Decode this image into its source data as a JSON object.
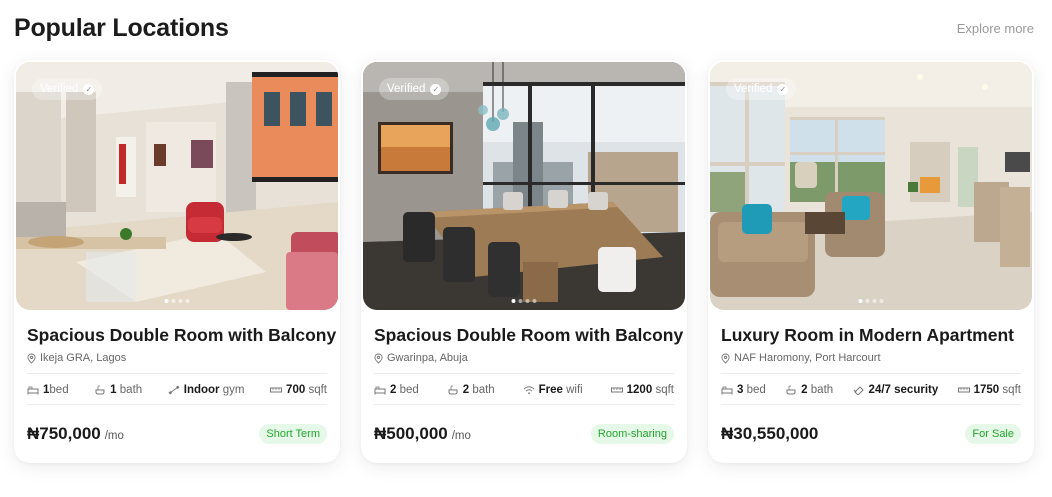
{
  "header": {
    "title": "Popular Locations",
    "explore_label": "Explore more"
  },
  "cards": [
    {
      "verified": "Verified",
      "name": "Spacious Double Room with Balcony",
      "location": "Ikeja GRA, Lagos",
      "features": [
        {
          "bold": "1",
          "text": "bed",
          "icon": "bed-icon"
        },
        {
          "bold": "1",
          "text": "bath",
          "icon": "bath-icon"
        },
        {
          "bold": "Indoor",
          "text": "gym",
          "icon": "dumbbell-icon"
        },
        {
          "bold": "700",
          "text": "sqft",
          "icon": "ruler-icon"
        }
      ],
      "price": "₦750,000",
      "per": "/mo",
      "tag": "Short Term"
    },
    {
      "verified": "Verified",
      "name": "Spacious Double Room with Balcony",
      "location": "Gwarinpa, Abuja",
      "features": [
        {
          "bold": "2",
          "text": "bed",
          "icon": "bed-icon"
        },
        {
          "bold": "2",
          "text": "bath",
          "icon": "bath-icon"
        },
        {
          "bold": "Free",
          "text": "wifi",
          "icon": "wifi-icon"
        },
        {
          "bold": "1200",
          "text": "sqft",
          "icon": "ruler-icon"
        }
      ],
      "price": "₦500,000",
      "per": "/mo",
      "tag": "Room-sharing"
    },
    {
      "verified": "Verified",
      "name": "Luxury Room in Modern Apartment",
      "location": "NAF Haromony, Port Harcourt",
      "features": [
        {
          "bold": "3",
          "text": "bed",
          "icon": "bed-icon"
        },
        {
          "bold": "2",
          "text": "bath",
          "icon": "bath-icon"
        },
        {
          "bold": "24/7",
          "text": "security",
          "icon": "security-icon"
        },
        {
          "bold": "1750",
          "text": "sqft",
          "icon": "ruler-icon"
        }
      ],
      "price": "₦30,550,000",
      "per": "",
      "tag": "For Sale"
    }
  ]
}
